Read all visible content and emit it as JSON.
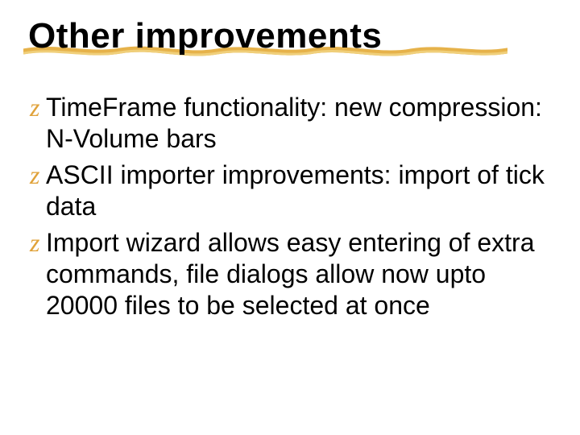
{
  "title": "Other improvements",
  "bullet_glyph": "z",
  "bullets": [
    "TimeFrame functionality: new compression: N-Volume bars",
    "ASCII importer improvements: import of tick data",
    "Import wizard allows easy entering of extra commands, file dialogs allow now upto 20000 files to be selected at once"
  ],
  "colors": {
    "accent": "#e0a23a"
  }
}
